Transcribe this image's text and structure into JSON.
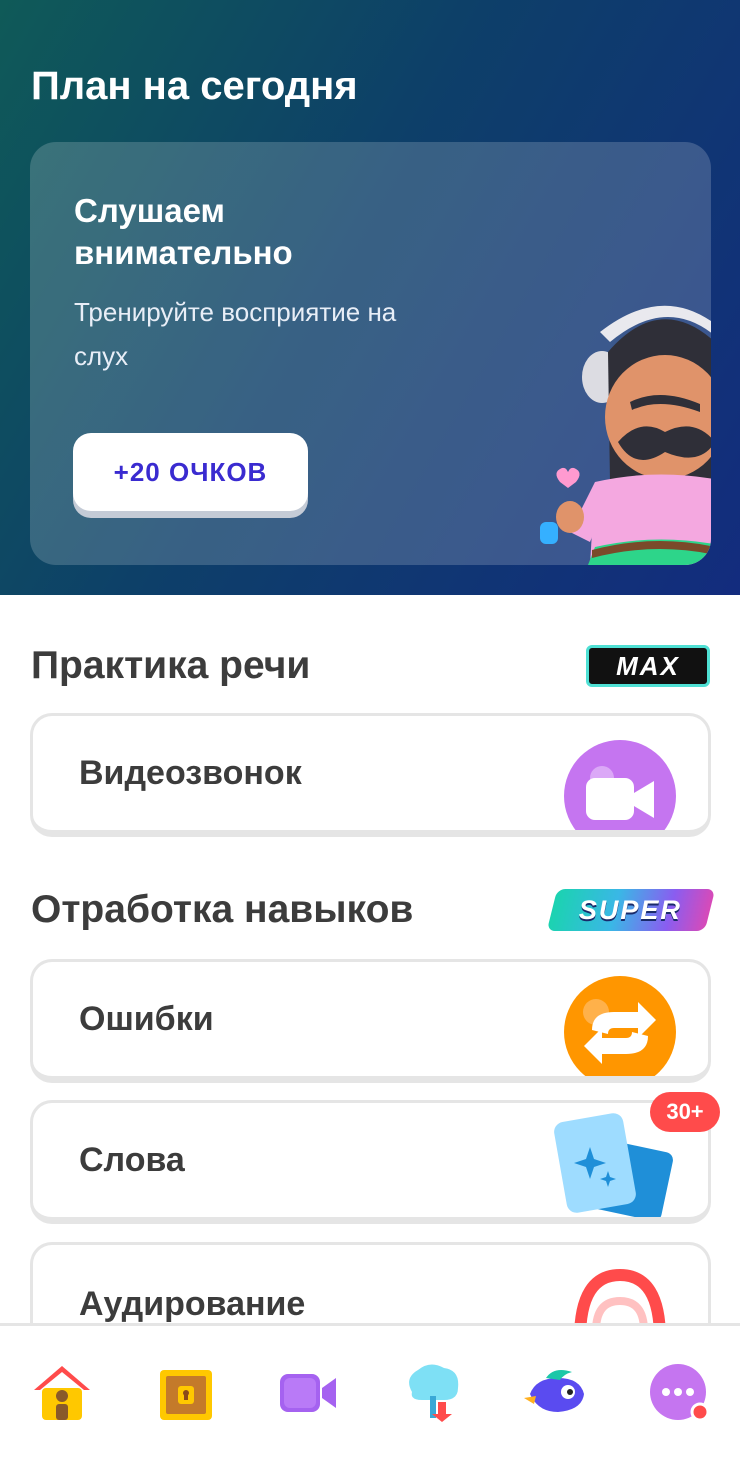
{
  "hero": {
    "title": "План на сегодня",
    "card": {
      "title": "Слушаем внимательно",
      "subtitle": "Тренируйте восприятие на слух",
      "points_button": "+20 ОЧКОВ"
    }
  },
  "sections": {
    "speech": {
      "title": "Практика речи",
      "badge": "MAX"
    },
    "skills": {
      "title": "Отработка навыков",
      "badge": "SUPER"
    }
  },
  "rows": {
    "video_call": {
      "label": "Видеозвонок",
      "icon": "video-camera-icon"
    },
    "mistakes": {
      "label": "Ошибки",
      "icon": "refresh-arrows-icon"
    },
    "words": {
      "label": "Слова",
      "icon": "flashcards-icon",
      "count": "30+"
    },
    "listening": {
      "label": "Аудирование",
      "icon": "headphones-icon"
    }
  },
  "tabbar": {
    "items": [
      "home-icon",
      "treasure-chest-icon",
      "video-camera-icon",
      "tree-download-icon",
      "duo-bird-icon",
      "more-icon"
    ]
  },
  "colors": {
    "hero_start": "#0f5a58",
    "hero_end": "#132c7e",
    "accent_blue": "#3a2bd0",
    "notification_red": "#ff4b4b"
  }
}
